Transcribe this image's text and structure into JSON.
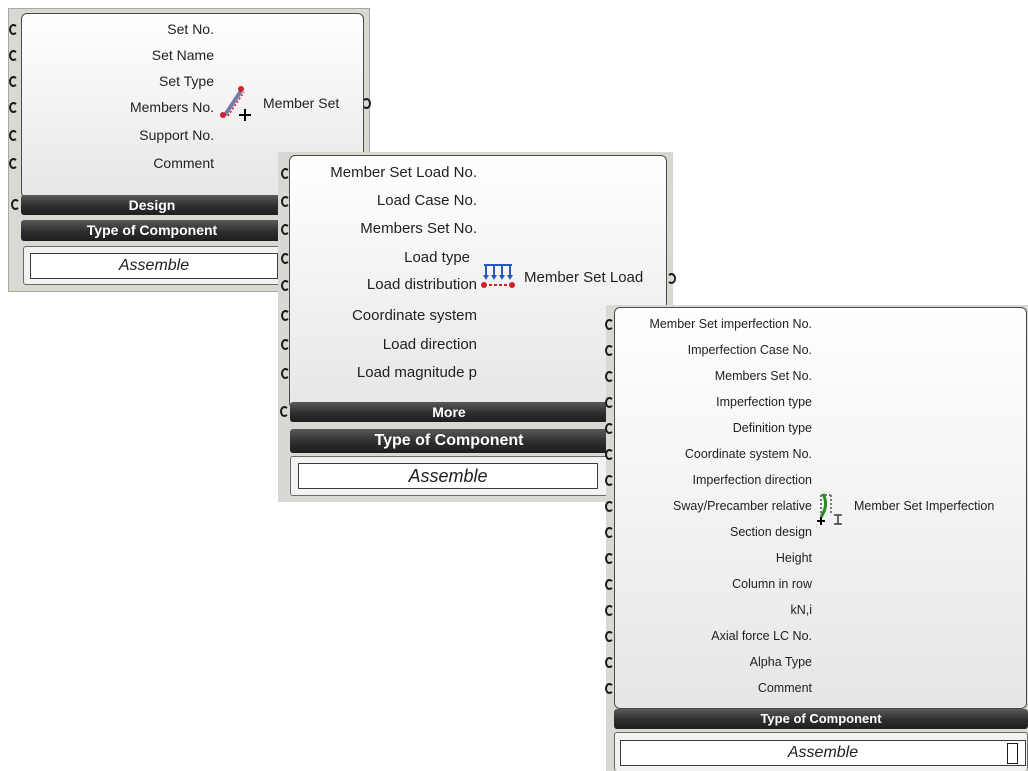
{
  "member_set": {
    "inputs": [
      "Set No.",
      "Set Name",
      "Set Type",
      "Members No.",
      "Support No.",
      "Comment"
    ],
    "output": "Member Set",
    "icon": "member-set-icon",
    "bars": [
      "Design",
      "Type of Component"
    ],
    "value": "Assemble"
  },
  "member_set_load": {
    "inputs": [
      "Member Set Load No.",
      "Load Case No.",
      "Members Set No.",
      "Load type",
      "Load distribution",
      "Coordinate system",
      "Load direction",
      "Load magnitude p"
    ],
    "output": "Member Set Load",
    "icon": "member-load-icon",
    "bars": [
      "More",
      "Type of Component"
    ],
    "value": "Assemble"
  },
  "member_set_imperfection": {
    "inputs": [
      "Member Set imperfection No.",
      "Imperfection Case No.",
      "Members Set No.",
      "Imperfection type",
      "Definition type",
      "Coordinate system No.",
      "Imperfection direction",
      "Sway/Precamber relative",
      "Section design",
      "Height",
      "Column in row",
      "kN,i",
      "Axial force LC No.",
      "Alpha Type",
      "Comment"
    ],
    "output": "Member Set Imperfection",
    "icon": "member-imperfection-icon",
    "bars": [
      "Type of Component"
    ],
    "value": "Assemble"
  },
  "colors": {
    "bar": "#2e2e2e",
    "canvas": "#d9d9d4",
    "icon_red": "#d0202a",
    "icon_green": "#2a8a2a",
    "icon_blue": "#2a5ab8"
  }
}
